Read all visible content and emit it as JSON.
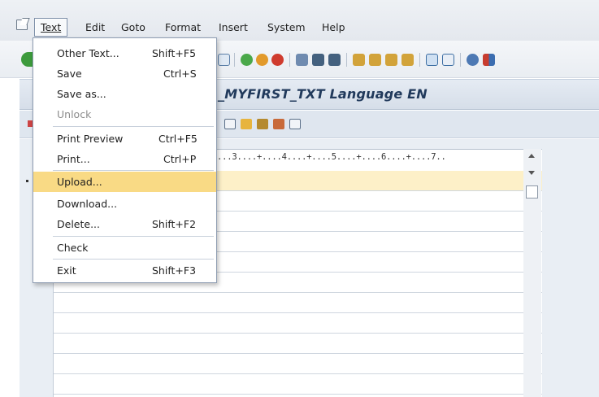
{
  "menubar": {
    "items": [
      {
        "label": "Text",
        "active": true
      },
      {
        "label": "Edit"
      },
      {
        "label": "Goto"
      },
      {
        "label": "Format"
      },
      {
        "label": "Insert"
      },
      {
        "label": "System"
      },
      {
        "label": "Help"
      }
    ]
  },
  "title": "_MYFIRST_TXT Language EN",
  "title_prefix_hidden": "Y",
  "editor": {
    "ruler": "...3....+....4....+....5....+....6....+....7.."
  },
  "dropdown": {
    "items": [
      {
        "label": "Other Text...",
        "shortcut": "Shift+F5"
      },
      {
        "label": "Save",
        "shortcut": "Ctrl+S"
      },
      {
        "label": "Save as...",
        "shortcut": ""
      },
      {
        "label": "Unlock",
        "shortcut": "",
        "disabled": true
      },
      {
        "label": "Print Preview",
        "shortcut": "Ctrl+F5"
      },
      {
        "label": "Print...",
        "shortcut": "Ctrl+P"
      },
      {
        "label": "Upload...",
        "shortcut": "",
        "selected": true
      },
      {
        "label": "Download...",
        "shortcut": ""
      },
      {
        "label": "Delete...",
        "shortcut": "Shift+F2"
      },
      {
        "label": "Check",
        "shortcut": ""
      },
      {
        "label": "Exit",
        "shortcut": "Shift+F3"
      }
    ]
  },
  "colors": {
    "selection": "#f9da85",
    "highlight_row": "#fdf0c8",
    "title_text": "#213a5c"
  }
}
